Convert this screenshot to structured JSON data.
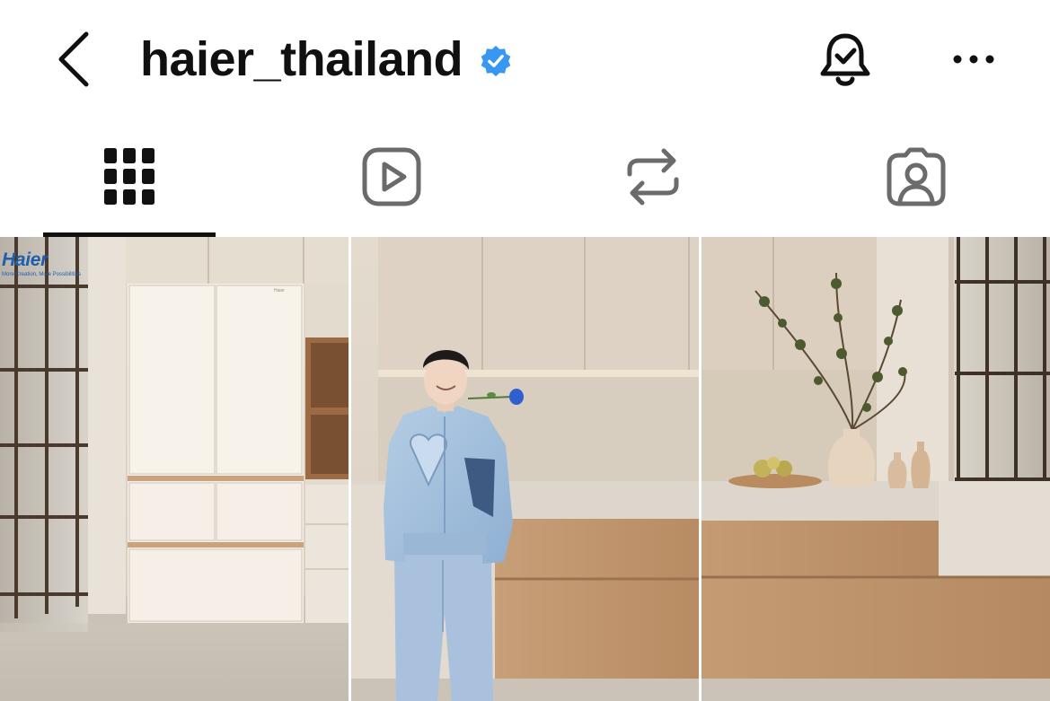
{
  "header": {
    "back_icon": "chevron-left-icon",
    "username": "haier_thailand",
    "verified_icon": "verified-badge-icon",
    "bell_icon": "bell-check-icon",
    "more_icon": "more-horizontal-icon"
  },
  "tabs": [
    {
      "icon": "grid-icon",
      "active": true
    },
    {
      "icon": "reels-play-icon",
      "active": false
    },
    {
      "icon": "repost-icon",
      "active": false
    },
    {
      "icon": "tagged-person-icon",
      "active": false
    }
  ],
  "posts": {
    "brand_name": "Haier",
    "brand_tagline": "More Creation, More Possibilities",
    "fridge_label": "Haier"
  },
  "colors": {
    "text": "#101010",
    "verified": "#3897f0",
    "brand_blue": "#1f5fae",
    "icon_gray": "#6b6b6b"
  }
}
